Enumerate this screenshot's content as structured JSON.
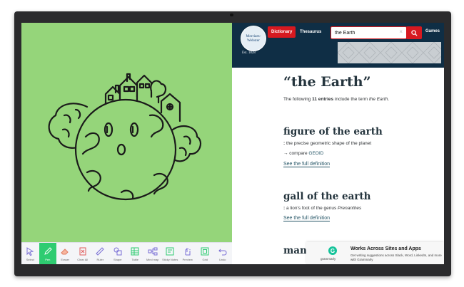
{
  "whiteboard": {
    "tools": [
      {
        "label": "Select",
        "icon": "select-icon"
      },
      {
        "label": "Pen",
        "icon": "pen-icon",
        "active": true
      },
      {
        "label": "Eraser",
        "icon": "eraser-icon"
      },
      {
        "label": "Clear All",
        "icon": "clear-all-icon"
      },
      {
        "label": "Ruler",
        "icon": "ruler-icon"
      },
      {
        "label": "Shape",
        "icon": "shape-icon"
      },
      {
        "label": "Table",
        "icon": "table-icon"
      },
      {
        "label": "Mind map",
        "icon": "mind-map-icon"
      },
      {
        "label": "Sticky Notes",
        "icon": "sticky-notes-icon"
      },
      {
        "label": "Preview",
        "icon": "preview-icon"
      },
      {
        "label": "Grid",
        "icon": "grid-icon"
      },
      {
        "label": "Undo",
        "icon": "undo-icon"
      }
    ],
    "canvas_color": "#95d57a",
    "active_color": "#2ecc71"
  },
  "header": {
    "logo_line1": "Merriam-",
    "logo_line2": "Webster",
    "est": "Est. 1828",
    "tab_dictionary": "Dictionary",
    "tab_thesaurus": "Thesaurus",
    "search_value": "the Earth",
    "search_clear": "×",
    "games": "Games"
  },
  "page": {
    "title": "“the Earth”",
    "intro_prefix": "The following ",
    "intro_count": "11 entries",
    "intro_mid": " include the term ",
    "intro_term": "the Earth",
    "intro_end": "."
  },
  "entries": [
    {
      "title": "figure of the earth",
      "def_colon": ":",
      "def_text": " the precise geometric shape of the planet",
      "cross_prefix": "→ compare ",
      "cross_link": "GEOID",
      "link": "See the full definition"
    },
    {
      "title": "gall of the earth",
      "def_colon": ":",
      "def_text": " a lion's foot of the genus ",
      "def_italic": "Prenanthes",
      "link": "See the full definition"
    },
    {
      "title": "man"
    }
  ],
  "grammarly": {
    "icon": "G",
    "name": "grammarly",
    "title": "Works Across Sites and Apps",
    "text": "Get writing suggestions across Slack, Word, LinkedIn, and more with Grammarly"
  },
  "colors": {
    "mw_navy": "#0f2e45",
    "mw_red": "#d71920",
    "link": "#265667",
    "grammarly_green": "#15c39a"
  }
}
